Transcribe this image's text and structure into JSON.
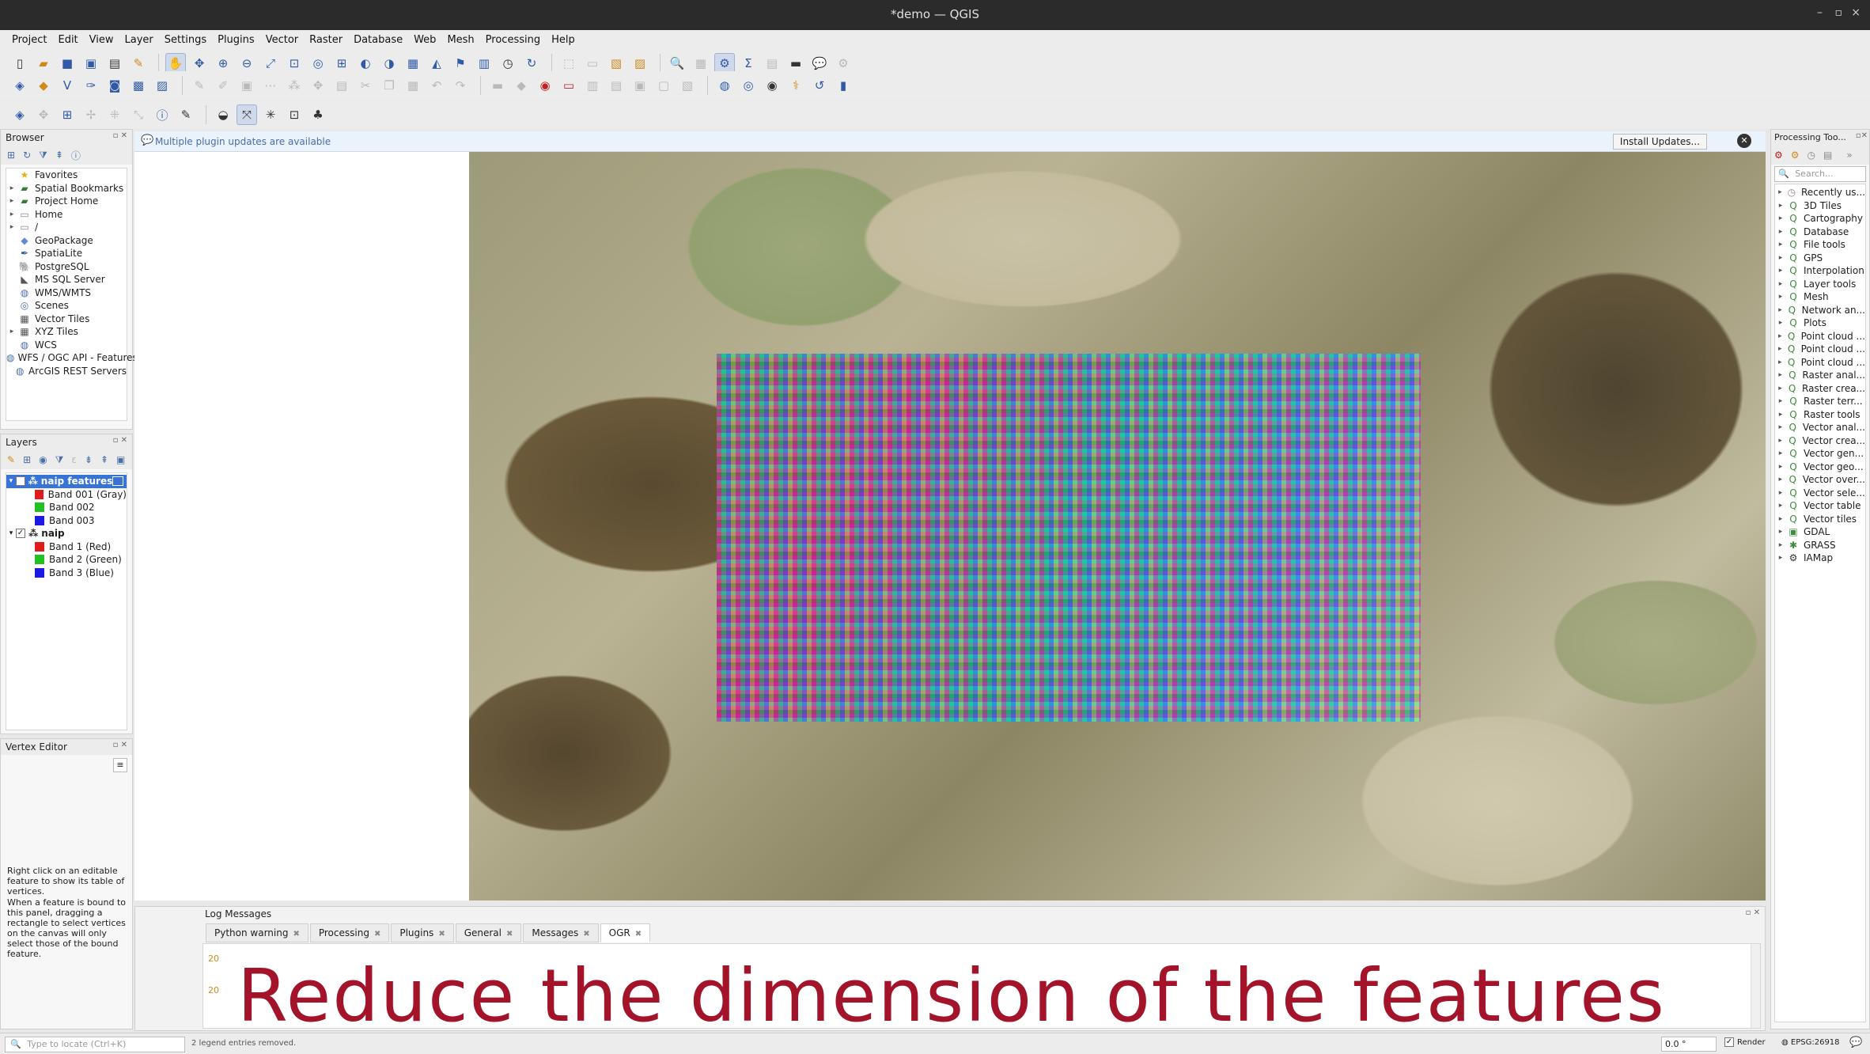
{
  "window": {
    "title": "*demo — QGIS",
    "controls": [
      "–",
      "▫",
      "×"
    ]
  },
  "menu": [
    "Project",
    "Edit",
    "View",
    "Layer",
    "Settings",
    "Plugins",
    "Vector",
    "Raster",
    "Database",
    "Web",
    "Mesh",
    "Processing",
    "Help"
  ],
  "message_bar": {
    "text": "Multiple plugin updates are available",
    "button": "Install Updates..."
  },
  "browser": {
    "title": "Browser",
    "items": [
      {
        "label": "Favorites",
        "icon": "star-icon"
      },
      {
        "label": "Spatial Bookmarks",
        "icon": "bookmark-icon"
      },
      {
        "label": "Project Home",
        "icon": "project-home-icon"
      },
      {
        "label": "Home",
        "icon": "folder-icon"
      },
      {
        "label": "/",
        "icon": "folder-icon"
      },
      {
        "label": "GeoPackage",
        "icon": "geopackage-icon"
      },
      {
        "label": "SpatiaLite",
        "icon": "spatialite-icon"
      },
      {
        "label": "PostgreSQL",
        "icon": "postgresql-icon"
      },
      {
        "label": "MS SQL Server",
        "icon": "mssql-icon"
      },
      {
        "label": "WMS/WMTS",
        "icon": "globe-icon"
      },
      {
        "label": "Scenes",
        "icon": "scenes-icon"
      },
      {
        "label": "Vector Tiles",
        "icon": "grid-icon"
      },
      {
        "label": "XYZ Tiles",
        "icon": "grid-icon"
      },
      {
        "label": "WCS",
        "icon": "globe-icon"
      },
      {
        "label": "WFS / OGC API - Features",
        "icon": "globe-icon"
      },
      {
        "label": "ArcGIS REST Servers",
        "icon": "globe-icon"
      }
    ]
  },
  "layers": {
    "title": "Layers",
    "items": [
      {
        "label": "naip features",
        "selected": true,
        "bands": [
          {
            "label": "Band 001 (Gray)",
            "color": "#e11b1b"
          },
          {
            "label": "Band 002",
            "color": "#22c022"
          },
          {
            "label": "Band 003",
            "color": "#1a1ae0"
          }
        ]
      },
      {
        "label": "naip",
        "selected": false,
        "bands": [
          {
            "label": "Band 1 (Red)",
            "color": "#e11b1b"
          },
          {
            "label": "Band 2 (Green)",
            "color": "#22c022"
          },
          {
            "label": "Band 3 (Blue)",
            "color": "#1a1ae0"
          }
        ]
      }
    ]
  },
  "vertex_editor": {
    "title": "Vertex Editor",
    "hint1": "Right click on an editable feature to show its table of vertices.",
    "hint2": "When a feature is bound to this panel, dragging a rectangle to select vertices on the canvas will only select those of the bound feature."
  },
  "processing": {
    "title": "Processing Too...",
    "search_placeholder": "Search...",
    "items": [
      {
        "label": "Recently us...",
        "icon": "clock-icon"
      },
      {
        "label": "3D Tiles"
      },
      {
        "label": "Cartography"
      },
      {
        "label": "Database"
      },
      {
        "label": "File tools"
      },
      {
        "label": "GPS"
      },
      {
        "label": "Interpolation"
      },
      {
        "label": "Layer tools"
      },
      {
        "label": "Mesh"
      },
      {
        "label": "Network an..."
      },
      {
        "label": "Plots"
      },
      {
        "label": "Point cloud ..."
      },
      {
        "label": "Point cloud ..."
      },
      {
        "label": "Point cloud ..."
      },
      {
        "label": "Raster anal..."
      },
      {
        "label": "Raster crea..."
      },
      {
        "label": "Raster terr..."
      },
      {
        "label": "Raster tools"
      },
      {
        "label": "Vector anal..."
      },
      {
        "label": "Vector crea..."
      },
      {
        "label": "Vector gen..."
      },
      {
        "label": "Vector geo..."
      },
      {
        "label": "Vector over..."
      },
      {
        "label": "Vector sele..."
      },
      {
        "label": "Vector table"
      },
      {
        "label": "Vector tiles"
      },
      {
        "label": "GDAL"
      },
      {
        "label": "GRASS"
      },
      {
        "label": "IAMap"
      }
    ]
  },
  "log": {
    "title": "Log Messages",
    "tabs": [
      "Python warning",
      "Processing",
      "Plugins",
      "General",
      "Messages",
      "OGR"
    ],
    "active_tab": "OGR",
    "line_numbers": [
      "20",
      "20"
    ]
  },
  "caption": "Reduce the dimension of the features",
  "statusbar": {
    "locate_placeholder": "Type to locate (Ctrl+K)",
    "legend_text": "2 legend entries removed.",
    "rotation": "0.0 °",
    "render_label": "Render",
    "crs": "EPSG:26918"
  },
  "colors": {
    "accent": "#3874d8",
    "caption": "#a3132a",
    "title_bar": "#2b2b2b"
  }
}
